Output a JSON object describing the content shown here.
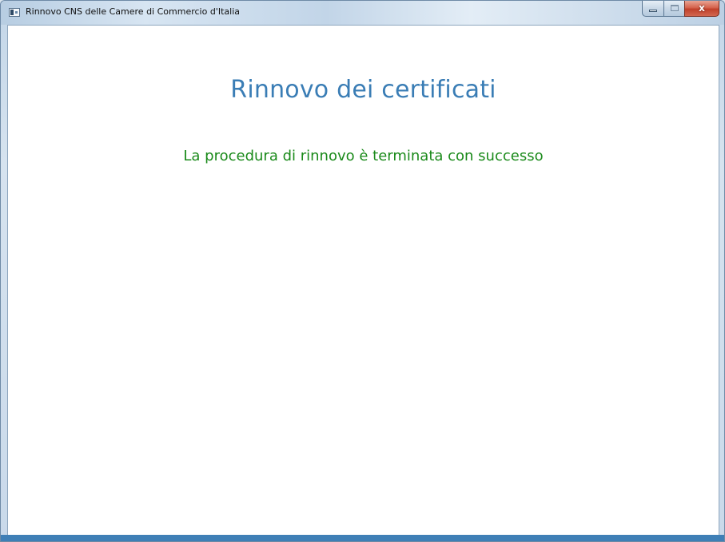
{
  "window": {
    "title": "Rinnovo CNS delle Camere di Commercio d'Italia",
    "close_glyph": "x"
  },
  "main": {
    "title": "Rinnovo dei certificati",
    "status_message": "La procedura di rinnovo è terminata con successo"
  },
  "icons": {
    "app": "app-window-icon",
    "minimize": "minimize-icon",
    "maximize": "maximize-icon",
    "close": "close-icon"
  },
  "colors": {
    "title": "#3a7db5",
    "success": "#1a8a1a",
    "accent_bar": "#3f7fb6"
  }
}
